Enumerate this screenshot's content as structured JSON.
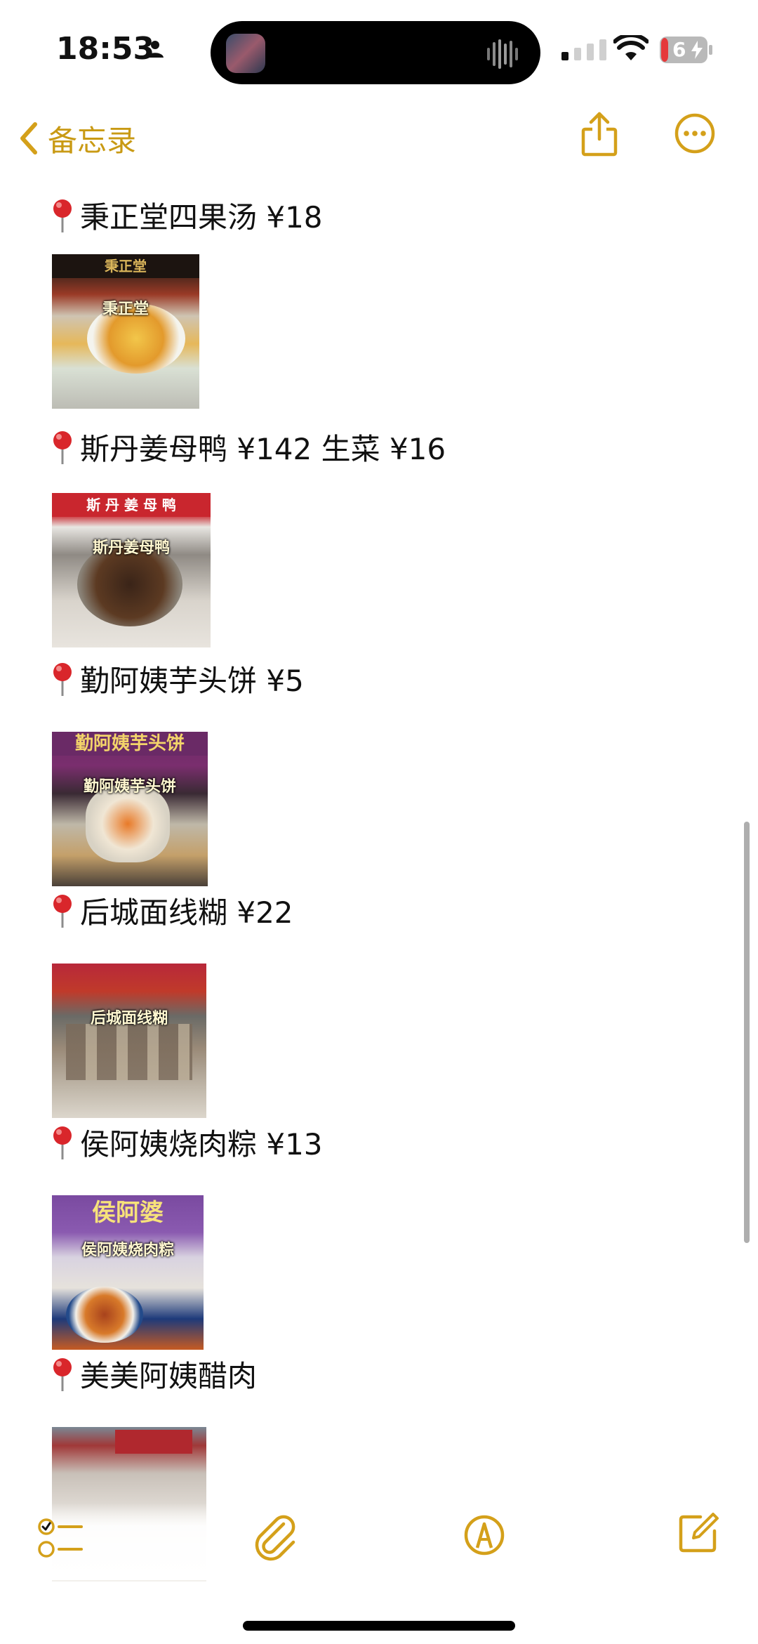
{
  "status_bar": {
    "time": "18:53",
    "battery": "6"
  },
  "nav": {
    "back_label": "备忘录"
  },
  "entries": [
    {
      "title": "秉正堂四果汤 ¥18",
      "caption": "秉正堂",
      "sign": "秉正堂"
    },
    {
      "title": "斯丹姜母鸭 ¥142 生菜 ¥16",
      "caption": "斯丹姜母鸭",
      "sign": "斯 丹 姜 母 鸭"
    },
    {
      "title": "勤阿姨芋头饼 ¥5",
      "caption": "勤阿姨芋头饼",
      "sign": "勤阿姨芋头饼"
    },
    {
      "title": "后城面线糊 ¥22",
      "caption": "后城面线糊",
      "sign": ""
    },
    {
      "title": "侯阿姨烧肉粽 ¥13",
      "caption": "侯阿姨烧肉粽",
      "sign": "侯阿婆"
    },
    {
      "title": "美美阿姨醋肉",
      "caption": "",
      "sign": ""
    }
  ],
  "colors": {
    "accent": "#d4a01a",
    "pin": "#d9262b"
  },
  "icons": {
    "back": "chevron-left-icon",
    "share": "share-icon",
    "more": "more-circle-icon",
    "checklist": "checklist-icon",
    "attach": "paperclip-icon",
    "markup": "pen-circle-icon",
    "compose": "compose-icon"
  }
}
